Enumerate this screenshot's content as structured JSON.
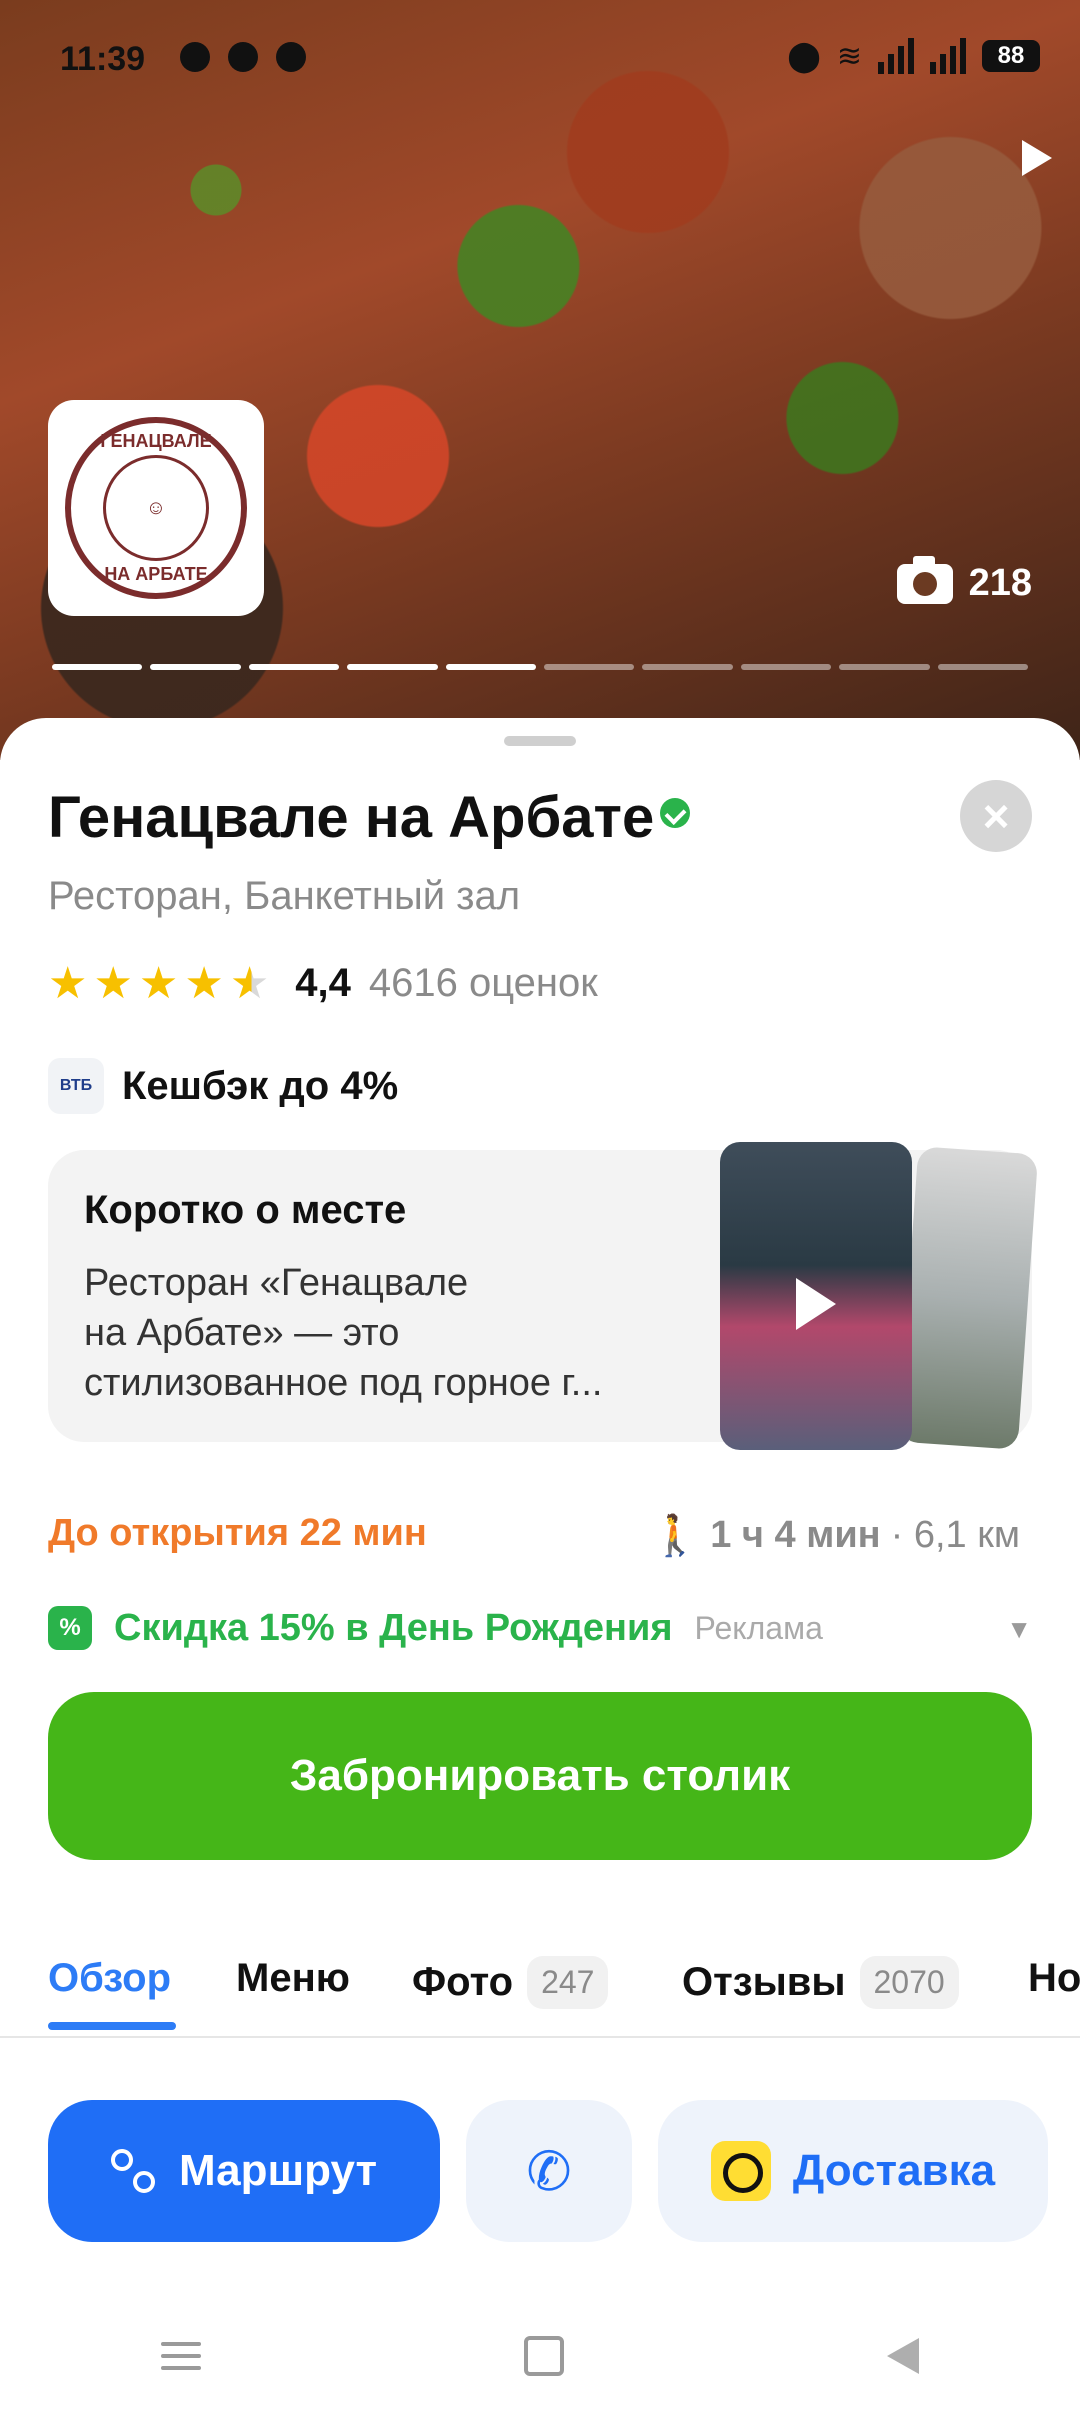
{
  "status_bar": {
    "time": "11:39",
    "battery": "88"
  },
  "hero": {
    "photo_count": "218"
  },
  "logo": {
    "top_text": "ГЕНАЦВАЛЕ",
    "bottom_text": "НА АРБАТЕ"
  },
  "place": {
    "name": "Генацвале на Арбате",
    "category": "Ресторан, Банкетный зал",
    "rating": "4,4",
    "rating_count": "4616 оценок"
  },
  "cashback": {
    "bank": "ВТБ",
    "text": "Кешбэк до 4%"
  },
  "about": {
    "title": "Коротко о месте",
    "text": "Ресторан «Генацвале\nна Арбате» — это\nстилизованное под горное г..."
  },
  "info": {
    "open_status": "До открытия 22 мин",
    "walk_time": "1 ч 4 мин",
    "distance": "· 6,1 км"
  },
  "promo": {
    "text": "Скидка 15% в День Рождения",
    "ad_label": "Реклама"
  },
  "booking": {
    "label": "Забронировать столик"
  },
  "tabs": [
    {
      "label": "Обзор"
    },
    {
      "label": "Меню"
    },
    {
      "label": "Фото",
      "count": "247"
    },
    {
      "label": "Отзывы",
      "count": "2070"
    },
    {
      "label": "Но"
    }
  ],
  "actions": {
    "route": "Маршрут",
    "delivery": "Доставка"
  },
  "colors": {
    "accent_blue": "#1f6ef6",
    "booking_green": "#45b618",
    "promo_green": "#2ab34b",
    "open_status_orange": "#f07a2a",
    "star_yellow": "#f7c000"
  }
}
